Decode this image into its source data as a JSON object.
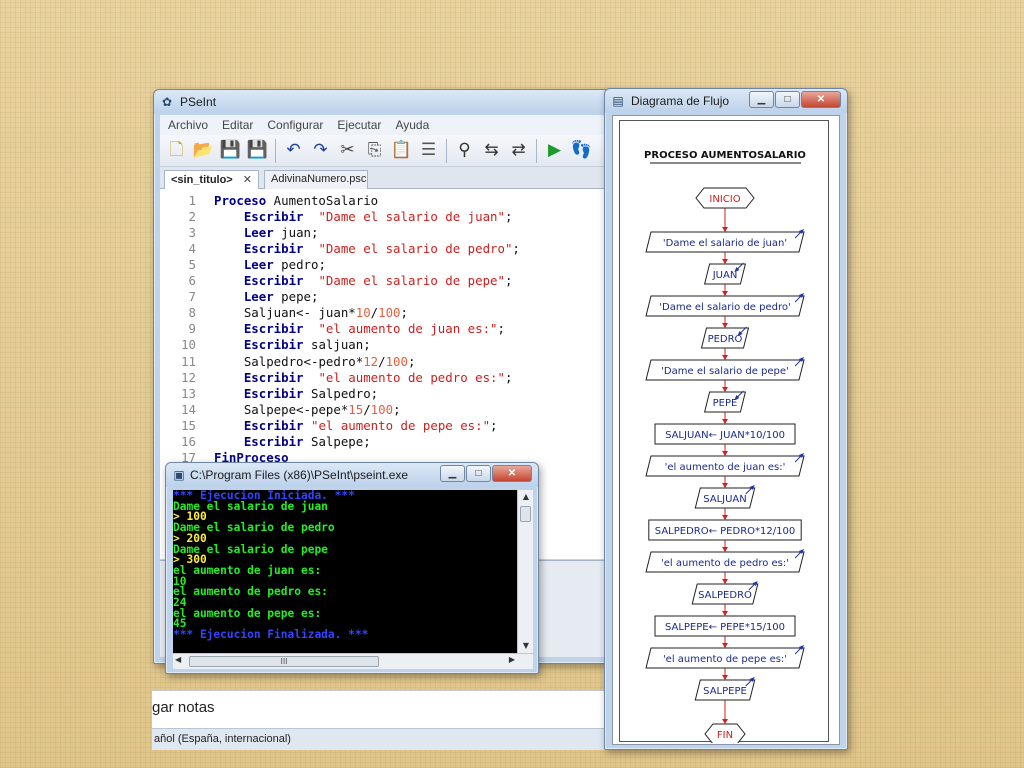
{
  "background_app": {
    "notes_text": "gar notas",
    "status_text": "añol (España, internacional)"
  },
  "pseint": {
    "title": "PSeInt",
    "menu": [
      "Archivo",
      "Editar",
      "Configurar",
      "Ejecutar",
      "Ayuda"
    ],
    "toolbar_icons": [
      "new-file-icon",
      "open-folder-icon",
      "save-icon",
      "save-as-icon",
      "undo-icon",
      "redo-icon",
      "cut-icon",
      "copy-icon",
      "paste-icon",
      "edit-list-icon",
      "find-icon",
      "find-previous-icon",
      "find-next-icon",
      "run-icon",
      "step-icon"
    ],
    "tabs": [
      {
        "label": "<sin_titulo>",
        "close": "✕",
        "active": true
      },
      {
        "label": "AdivinaNumero.psc",
        "active": false
      }
    ],
    "code": [
      {
        "n": "1",
        "tokens": [
          {
            "t": "Proceso",
            "c": "kw"
          },
          {
            "t": " AumentoSalario",
            "c": "txt"
          }
        ],
        "indent": 0
      },
      {
        "n": "2",
        "tokens": [
          {
            "t": "Escribir",
            "c": "kw"
          },
          {
            "t": "  ",
            "c": "txt"
          },
          {
            "t": "\"Dame el salario de juan\"",
            "c": "str"
          },
          {
            "t": ";",
            "c": "txt"
          }
        ],
        "indent": 1
      },
      {
        "n": "3",
        "tokens": [
          {
            "t": "Leer",
            "c": "kw"
          },
          {
            "t": " juan;",
            "c": "txt"
          }
        ],
        "indent": 1
      },
      {
        "n": "4",
        "tokens": [
          {
            "t": "Escribir",
            "c": "kw"
          },
          {
            "t": "  ",
            "c": "txt"
          },
          {
            "t": "\"Dame el salario de pedro\"",
            "c": "str"
          },
          {
            "t": ";",
            "c": "txt"
          }
        ],
        "indent": 1
      },
      {
        "n": "5",
        "tokens": [
          {
            "t": "Leer",
            "c": "kw"
          },
          {
            "t": " pedro;",
            "c": "txt"
          }
        ],
        "indent": 1
      },
      {
        "n": "6",
        "tokens": [
          {
            "t": "Escribir",
            "c": "kw"
          },
          {
            "t": "  ",
            "c": "txt"
          },
          {
            "t": "\"Dame el salario de pepe\"",
            "c": "str"
          },
          {
            "t": ";",
            "c": "txt"
          }
        ],
        "indent": 1
      },
      {
        "n": "7",
        "tokens": [
          {
            "t": "Leer",
            "c": "kw"
          },
          {
            "t": " pepe;",
            "c": "txt"
          }
        ],
        "indent": 1
      },
      {
        "n": "8",
        "tokens": [
          {
            "t": "Saljuan<- juan*",
            "c": "txt"
          },
          {
            "t": "10",
            "c": "num"
          },
          {
            "t": "/",
            "c": "txt"
          },
          {
            "t": "100",
            "c": "num"
          },
          {
            "t": ";",
            "c": "txt"
          }
        ],
        "indent": 1
      },
      {
        "n": "9",
        "tokens": [
          {
            "t": "Escribir",
            "c": "kw"
          },
          {
            "t": "  ",
            "c": "txt"
          },
          {
            "t": "\"el aumento de juan es:\"",
            "c": "str"
          },
          {
            "t": ";",
            "c": "txt"
          }
        ],
        "indent": 1
      },
      {
        "n": "10",
        "tokens": [
          {
            "t": "Escribir",
            "c": "kw"
          },
          {
            "t": " saljuan;",
            "c": "txt"
          }
        ],
        "indent": 1
      },
      {
        "n": "11",
        "tokens": [
          {
            "t": "Salpedro<-pedro*",
            "c": "txt"
          },
          {
            "t": "12",
            "c": "num"
          },
          {
            "t": "/",
            "c": "txt"
          },
          {
            "t": "100",
            "c": "num"
          },
          {
            "t": ";",
            "c": "txt"
          }
        ],
        "indent": 1
      },
      {
        "n": "12",
        "tokens": [
          {
            "t": "Escribir",
            "c": "kw"
          },
          {
            "t": "  ",
            "c": "txt"
          },
          {
            "t": "\"el aumento de pedro es:\"",
            "c": "str"
          },
          {
            "t": ";",
            "c": "txt"
          }
        ],
        "indent": 1
      },
      {
        "n": "13",
        "tokens": [
          {
            "t": "Escribir",
            "c": "kw"
          },
          {
            "t": " Salpedro;",
            "c": "txt"
          }
        ],
        "indent": 1
      },
      {
        "n": "14",
        "tokens": [
          {
            "t": "Salpepe<-pepe*",
            "c": "txt"
          },
          {
            "t": "15",
            "c": "num"
          },
          {
            "t": "/",
            "c": "txt"
          },
          {
            "t": "100",
            "c": "num"
          },
          {
            "t": ";",
            "c": "txt"
          }
        ],
        "indent": 1
      },
      {
        "n": "15",
        "tokens": [
          {
            "t": "Escribir",
            "c": "kw"
          },
          {
            "t": " ",
            "c": "txt"
          },
          {
            "t": "\"el aumento de pepe es:\"",
            "c": "str"
          },
          {
            "t": ";",
            "c": "txt"
          }
        ],
        "indent": 1
      },
      {
        "n": "16",
        "tokens": [
          {
            "t": "Escribir",
            "c": "kw"
          },
          {
            "t": " Salpepe;",
            "c": "txt"
          }
        ],
        "indent": 1
      },
      {
        "n": "17",
        "tokens": [
          {
            "t": "FinProceso",
            "c": "kw"
          }
        ],
        "indent": 0
      }
    ]
  },
  "console": {
    "title": "C:\\Program Files (x86)\\PSeInt\\pseint.exe",
    "scroll_thumb": "III",
    "lines": [
      {
        "text": "*** Ejecucion Iniciada. ***",
        "color": "blue"
      },
      {
        "text": "Dame el salario de juan",
        "color": "green"
      },
      {
        "text": "> 100",
        "color": "yellow"
      },
      {
        "text": "Dame el salario de pedro",
        "color": "green"
      },
      {
        "text": "> 200",
        "color": "yellow"
      },
      {
        "text": "Dame el salario de pepe",
        "color": "green"
      },
      {
        "text": "> 300",
        "color": "yellow"
      },
      {
        "text": "el aumento de juan es:",
        "color": "green"
      },
      {
        "text": "10",
        "color": "green"
      },
      {
        "text": "el aumento de pedro es:",
        "color": "green"
      },
      {
        "text": "24",
        "color": "green"
      },
      {
        "text": "el aumento de pepe es:",
        "color": "green"
      },
      {
        "text": "45",
        "color": "green"
      },
      {
        "text": "*** Ejecucion Finalizada. ***",
        "color": "blue"
      }
    ]
  },
  "flow": {
    "title": "Diagrama de Flujo",
    "heading": "PROCESO AUMENTOSALARIO",
    "nodes": [
      {
        "type": "start",
        "label": "INICIO"
      },
      {
        "type": "output",
        "label": "'Dame el salario de juan'"
      },
      {
        "type": "input",
        "label": "JUAN"
      },
      {
        "type": "output",
        "label": "'Dame el salario de pedro'"
      },
      {
        "type": "input",
        "label": "PEDRO"
      },
      {
        "type": "output",
        "label": "'Dame el salario de pepe'"
      },
      {
        "type": "input",
        "label": "PEPE"
      },
      {
        "type": "process",
        "label": "SALJUAN← JUAN*10/100"
      },
      {
        "type": "output",
        "label": "'el aumento de juan es:'"
      },
      {
        "type": "output",
        "label": "SALJUAN"
      },
      {
        "type": "process",
        "label": "SALPEDRO← PEDRO*12/100"
      },
      {
        "type": "output",
        "label": "'el aumento de pedro es:'"
      },
      {
        "type": "output",
        "label": "SALPEDRO"
      },
      {
        "type": "process",
        "label": "SALPEPE← PEPE*15/100"
      },
      {
        "type": "output",
        "label": "'el aumento de pepe es:'"
      },
      {
        "type": "output",
        "label": "SALPEPE"
      },
      {
        "type": "end",
        "label": "FIN"
      }
    ]
  },
  "colors": {
    "keyword": "#00008b",
    "string": "#cc2020",
    "number": "#e06040",
    "flow_line": "#cc2222",
    "flow_text": "#1a2a8a",
    "flow_arrow_io": "#2233aa"
  },
  "window_buttons": {
    "minimize": "▁",
    "maximize": "□",
    "close": "✕"
  }
}
